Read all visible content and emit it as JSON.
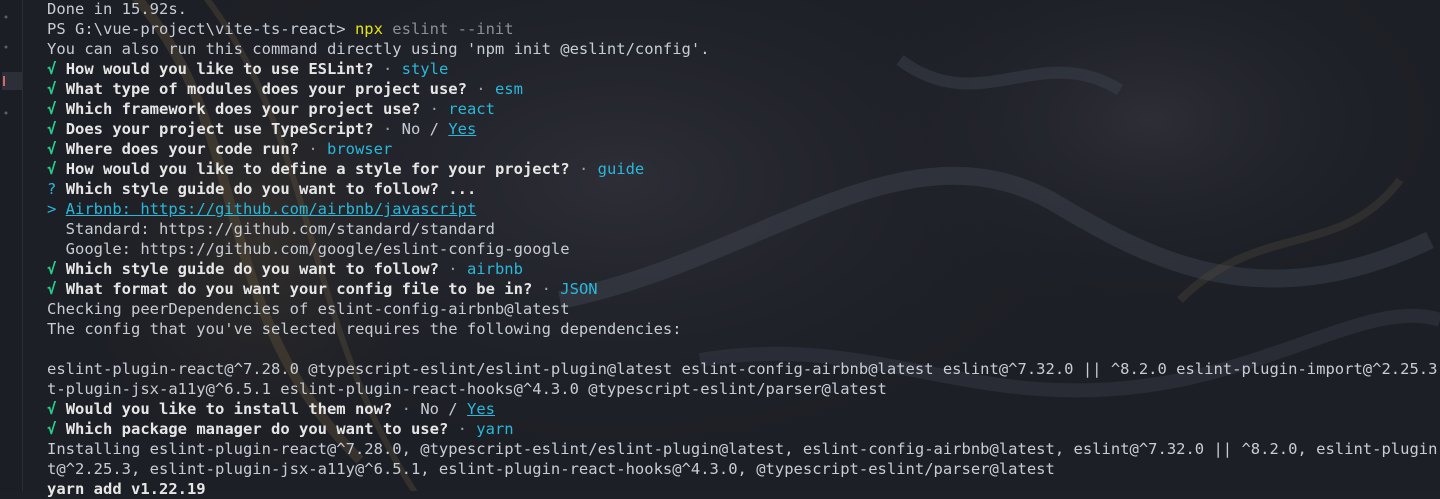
{
  "terminal": {
    "lines": [
      {
        "type": "plain",
        "text": "Done in 15.92s."
      },
      {
        "type": "prompt",
        "prompt": "PS G:\\vue-project\\vite-ts-react> ",
        "command": "npx",
        "args": " eslint --init"
      },
      {
        "type": "plain",
        "text": "You can also run this command directly using 'npm init @eslint/config'."
      },
      {
        "type": "qa",
        "mark": "√",
        "question": "How would you like to use ESLint?",
        "sep": " · ",
        "answer": "style"
      },
      {
        "type": "qa",
        "mark": "√",
        "question": "What type of modules does your project use?",
        "sep": " · ",
        "answer": "esm"
      },
      {
        "type": "qa",
        "mark": "√",
        "question": "Which framework does your project use?",
        "sep": " · ",
        "answer": "react"
      },
      {
        "type": "qa-yn",
        "mark": "√",
        "question": "Does your project use TypeScript?",
        "sep": " · ",
        "no": "No / ",
        "yes": "Yes"
      },
      {
        "type": "qa",
        "mark": "√",
        "question": "Where does your code run?",
        "sep": " · ",
        "answer": "browser"
      },
      {
        "type": "qa",
        "mark": "√",
        "question": "How would you like to define a style for your project?",
        "sep": " · ",
        "answer": "guide"
      },
      {
        "type": "pending",
        "mark": "?",
        "question": "Which style guide do you want to follow?",
        "suffix": " ..."
      },
      {
        "type": "option-selected",
        "pointer": "> ",
        "text": "Airbnb: https://github.com/airbnb/javascript"
      },
      {
        "type": "option",
        "text": "  Standard: https://github.com/standard/standard"
      },
      {
        "type": "option",
        "text": "  Google: https://github.com/google/eslint-config-google"
      },
      {
        "type": "qa",
        "mark": "√",
        "question": "Which style guide do you want to follow?",
        "sep": " · ",
        "answer": "airbnb"
      },
      {
        "type": "qa",
        "mark": "√",
        "question": "What format do you want your config file to be in?",
        "sep": " · ",
        "answer": "JSON"
      },
      {
        "type": "plain",
        "text": "Checking peerDependencies of eslint-config-airbnb@latest"
      },
      {
        "type": "plain",
        "text": "The config that you've selected requires the following dependencies:"
      },
      {
        "type": "plain",
        "text": ""
      },
      {
        "type": "plain",
        "text": "eslint-plugin-react@^7.28.0 @typescript-eslint/eslint-plugin@latest eslint-config-airbnb@latest eslint@^7.32.0 || ^8.2.0 eslint-plugin-import@^2.25.3 eslin"
      },
      {
        "type": "plain",
        "text": "t-plugin-jsx-a11y@^6.5.1 eslint-plugin-react-hooks@^4.3.0 @typescript-eslint/parser@latest"
      },
      {
        "type": "qa-yn",
        "mark": "√",
        "question": "Would you like to install them now?",
        "sep": " · ",
        "no": "No / ",
        "yes": "Yes"
      },
      {
        "type": "qa",
        "mark": "√",
        "question": "Which package manager do you want to use?",
        "sep": " · ",
        "answer": "yarn"
      },
      {
        "type": "plain",
        "text": "Installing eslint-plugin-react@^7.28.0, @typescript-eslint/eslint-plugin@latest, eslint-config-airbnb@latest, eslint@^7.32.0 || ^8.2.0, eslint-plugin-impor"
      },
      {
        "type": "plain",
        "text": "t@^2.25.3, eslint-plugin-jsx-a11y@^6.5.1, eslint-plugin-react-hooks@^4.3.0, @typescript-eslint/parser@latest"
      },
      {
        "type": "bold",
        "text": "yarn add v1.22.19"
      }
    ]
  },
  "colors": {
    "background": "#1e2027",
    "text": "#c8ccd4",
    "check": "#23d18b",
    "answer": "#29b8db",
    "command": "#e5e510"
  }
}
